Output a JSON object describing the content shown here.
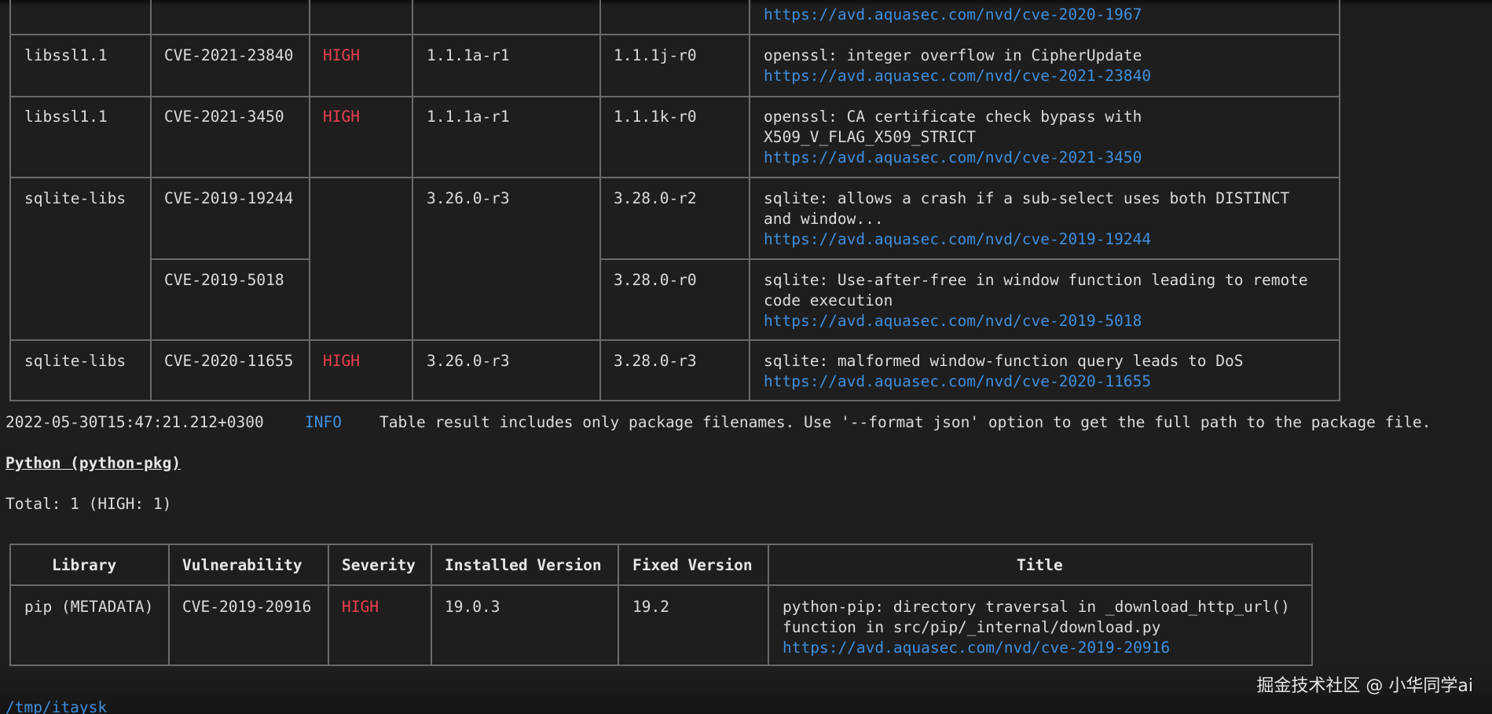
{
  "table1": {
    "partial_row": {
      "link": "https://avd.aquasec.com/nvd/cve-2020-1967"
    },
    "rows": [
      {
        "library": "libssl1.1",
        "vuln": "CVE-2021-23840",
        "severity": "HIGH",
        "installed": "1.1.1a-r1",
        "fixed": "1.1.1j-r0",
        "title": [
          "openssl: integer overflow in CipherUpdate"
        ],
        "link": "https://avd.aquasec.com/nvd/cve-2021-23840"
      },
      {
        "library": "libssl1.1",
        "vuln": "CVE-2021-3450",
        "severity": "HIGH",
        "installed": "1.1.1a-r1",
        "fixed": "1.1.1k-r0",
        "title": [
          "openssl: CA certificate check bypass with",
          "X509_V_FLAG_X509_STRICT"
        ],
        "link": "https://avd.aquasec.com/nvd/cve-2021-3450"
      },
      {
        "library": "sqlite-libs",
        "vuln": "CVE-2019-19244",
        "severity": "",
        "installed": "3.26.0-r3",
        "fixed": "3.28.0-r2",
        "title": [
          "sqlite: allows a crash if a sub-select uses both DISTINCT",
          "and window..."
        ],
        "link": "https://avd.aquasec.com/nvd/cve-2019-19244"
      },
      {
        "library": "",
        "vuln": "CVE-2019-5018",
        "severity": "",
        "installed": "",
        "fixed": "3.28.0-r0",
        "title": [
          "sqlite: Use-after-free in window function leading to remote",
          "code execution"
        ],
        "link": "https://avd.aquasec.com/nvd/cve-2019-5018"
      },
      {
        "library": "sqlite-libs",
        "vuln": "CVE-2020-11655",
        "severity": "HIGH",
        "installed": "3.26.0-r3",
        "fixed": "3.28.0-r3",
        "title": [
          "sqlite: malformed window-function query leads to DoS"
        ],
        "link": "https://avd.aquasec.com/nvd/cve-2020-11655"
      }
    ]
  },
  "log": {
    "timestamp": "2022-05-30T15:47:21.212+0300",
    "level": "INFO",
    "message": "Table result includes only package filenames. Use '--format json' option to get the full path to the package file."
  },
  "section": {
    "heading": "Python (python-pkg)",
    "total": "Total: 1 (HIGH: 1)"
  },
  "table2": {
    "headers": [
      "Library",
      "Vulnerability",
      "Severity",
      "Installed Version",
      "Fixed Version",
      "Title"
    ],
    "row": {
      "library": "pip (METADATA)",
      "vuln": "CVE-2019-20916",
      "severity": "HIGH",
      "installed": "19.0.3",
      "fixed": "19.2",
      "title": [
        "python-pip: directory traversal in _download_http_url()",
        "function in src/pip/_internal/download.py"
      ],
      "link": "https://avd.aquasec.com/nvd/cve-2019-20916"
    }
  },
  "prompt": {
    "path": "/tmp/itaysk"
  },
  "watermark": "掘金技术社区 @ 小华同学ai",
  "colors": {
    "background": "#1e1e1e",
    "severity_high": "#e8404e",
    "link": "#3f8fdc",
    "grid": "#6a6a6a"
  }
}
